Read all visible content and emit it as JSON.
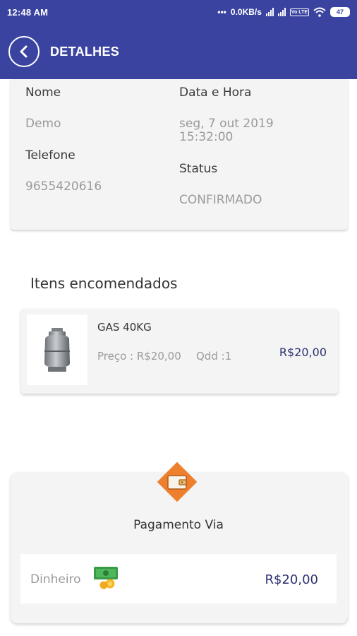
{
  "status_bar": {
    "time": "12:48 AM",
    "dots": "•••",
    "speed": "0.0KB/s",
    "volte": "Vo LTE",
    "battery": "47"
  },
  "app_bar": {
    "title": "DETALHES"
  },
  "details": {
    "name_label": "Nome",
    "name_value": "Demo",
    "phone_label": "Telefone",
    "phone_value": "9655420616",
    "datetime_label": "Data e Hora",
    "datetime_line1": "seg, 7 out 2019",
    "datetime_line2": "15:32:00",
    "status_label": "Status",
    "status_value": "CONFIRMADO"
  },
  "items_section": {
    "title": "Itens encomendados",
    "items": [
      {
        "name": "GAS 40KG",
        "price": "Preço : R$20,00",
        "qty": "Qdd :1",
        "total": "R$20,00",
        "icon": "gas-cylinder-icon"
      }
    ]
  },
  "payment": {
    "title": "Pagamento Via",
    "method": "Dinheiro",
    "amount": "R$20,00",
    "icon": "wallet-icon",
    "method_icon": "cash-icon"
  },
  "colors": {
    "primary": "#3a43a0",
    "accent": "#ee7f2d",
    "amount": "#2d3170",
    "card_bg": "#f4f4f5"
  }
}
